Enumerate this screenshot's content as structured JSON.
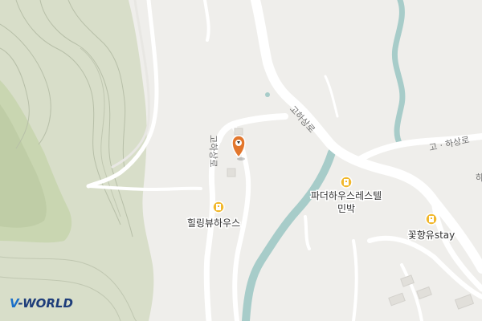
{
  "map": {
    "brand": {
      "left": "V",
      "right": "-WORLD"
    },
    "road_labels": [
      {
        "id": "road-gohasang-north",
        "text": "고하상로"
      },
      {
        "id": "road-gohasang-west",
        "text": "고하상로"
      },
      {
        "id": "road-gohasang-east",
        "text": "고 · 하상로"
      },
      {
        "id": "road-edge",
        "text": "하"
      }
    ],
    "places": [
      {
        "id": "healing-view-house",
        "name": "힐링뷰하우스",
        "icon": "lodging-icon"
      },
      {
        "id": "father-house-restel",
        "name": "파더하우스레스텔",
        "sub": "민박",
        "icon": "lodging-icon"
      },
      {
        "id": "kkot-hyang-yu-stay",
        "name": "꽃향유stay",
        "icon": "lodging-icon"
      }
    ],
    "marker": {
      "icon": "location-pin-icon"
    },
    "colors": {
      "background": "#efeeeb",
      "forest": "#c9d6b1",
      "water": "#a7ccc9",
      "road": "#ffffff",
      "poi_icon": "#f1b82d",
      "marker": "#e2762c"
    }
  }
}
